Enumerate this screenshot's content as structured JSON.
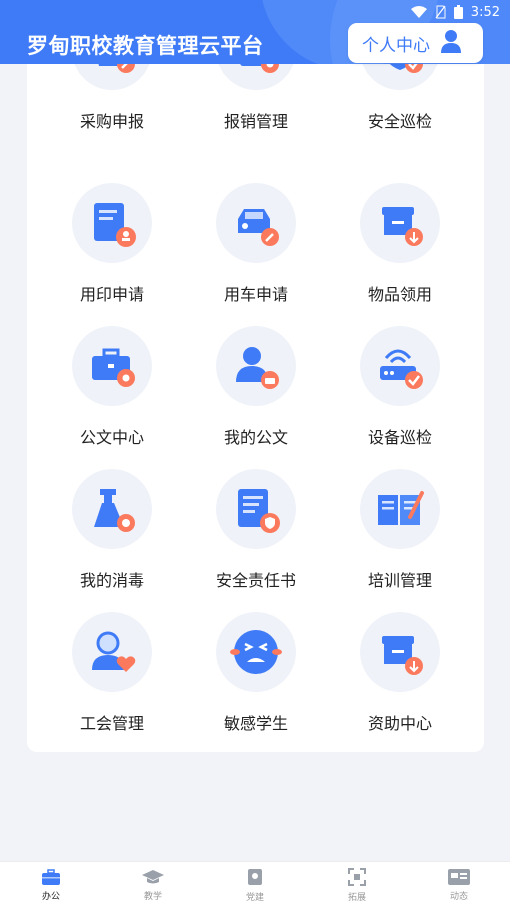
{
  "status_bar": {
    "time": "3:52",
    "wifi_icon": "wifi-icon",
    "sim_icon": "no-sim-icon",
    "battery_icon": "battery-icon"
  },
  "header": {
    "title": "罗甸职校教育管理云平台",
    "profile_button": "个人中心",
    "profile_icon": "person-icon"
  },
  "colors": {
    "primary": "#3f7bf6",
    "accent": "#fb7a5e",
    "icon_bg": "#eff2f8"
  },
  "grid": {
    "items": [
      {
        "label": "采购申报",
        "icon": "shopping-basket-icon"
      },
      {
        "label": "报销管理",
        "icon": "receipt-gear-icon"
      },
      {
        "label": "安全巡检",
        "icon": "shield-star-icon"
      },
      {
        "label": "用印申请",
        "icon": "document-stamp-icon"
      },
      {
        "label": "用车申请",
        "icon": "car-icon"
      },
      {
        "label": "物品领用",
        "icon": "box-download-icon"
      },
      {
        "label": "公文中心",
        "icon": "briefcase-gear-icon"
      },
      {
        "label": "我的公文",
        "icon": "person-briefcase-icon"
      },
      {
        "label": "设备巡检",
        "icon": "router-check-icon"
      },
      {
        "label": "我的消毒",
        "icon": "spray-bottle-icon"
      },
      {
        "label": "安全责任书",
        "icon": "document-shield-icon"
      },
      {
        "label": "培训管理",
        "icon": "open-book-pen-icon"
      },
      {
        "label": "工会管理",
        "icon": "person-heart-icon"
      },
      {
        "label": "敏感学生",
        "icon": "crying-face-icon"
      },
      {
        "label": "资助中心",
        "icon": "box-download-icon"
      }
    ]
  },
  "tabbar": {
    "tabs": [
      {
        "label": "办公",
        "icon": "briefcase-icon",
        "active": true
      },
      {
        "label": "教学",
        "icon": "graduation-cap-icon",
        "active": false
      },
      {
        "label": "党建",
        "icon": "party-emblem-icon",
        "active": false
      },
      {
        "label": "拓展",
        "icon": "expand-icon",
        "active": false
      },
      {
        "label": "动态",
        "icon": "news-icon",
        "active": false
      }
    ]
  }
}
